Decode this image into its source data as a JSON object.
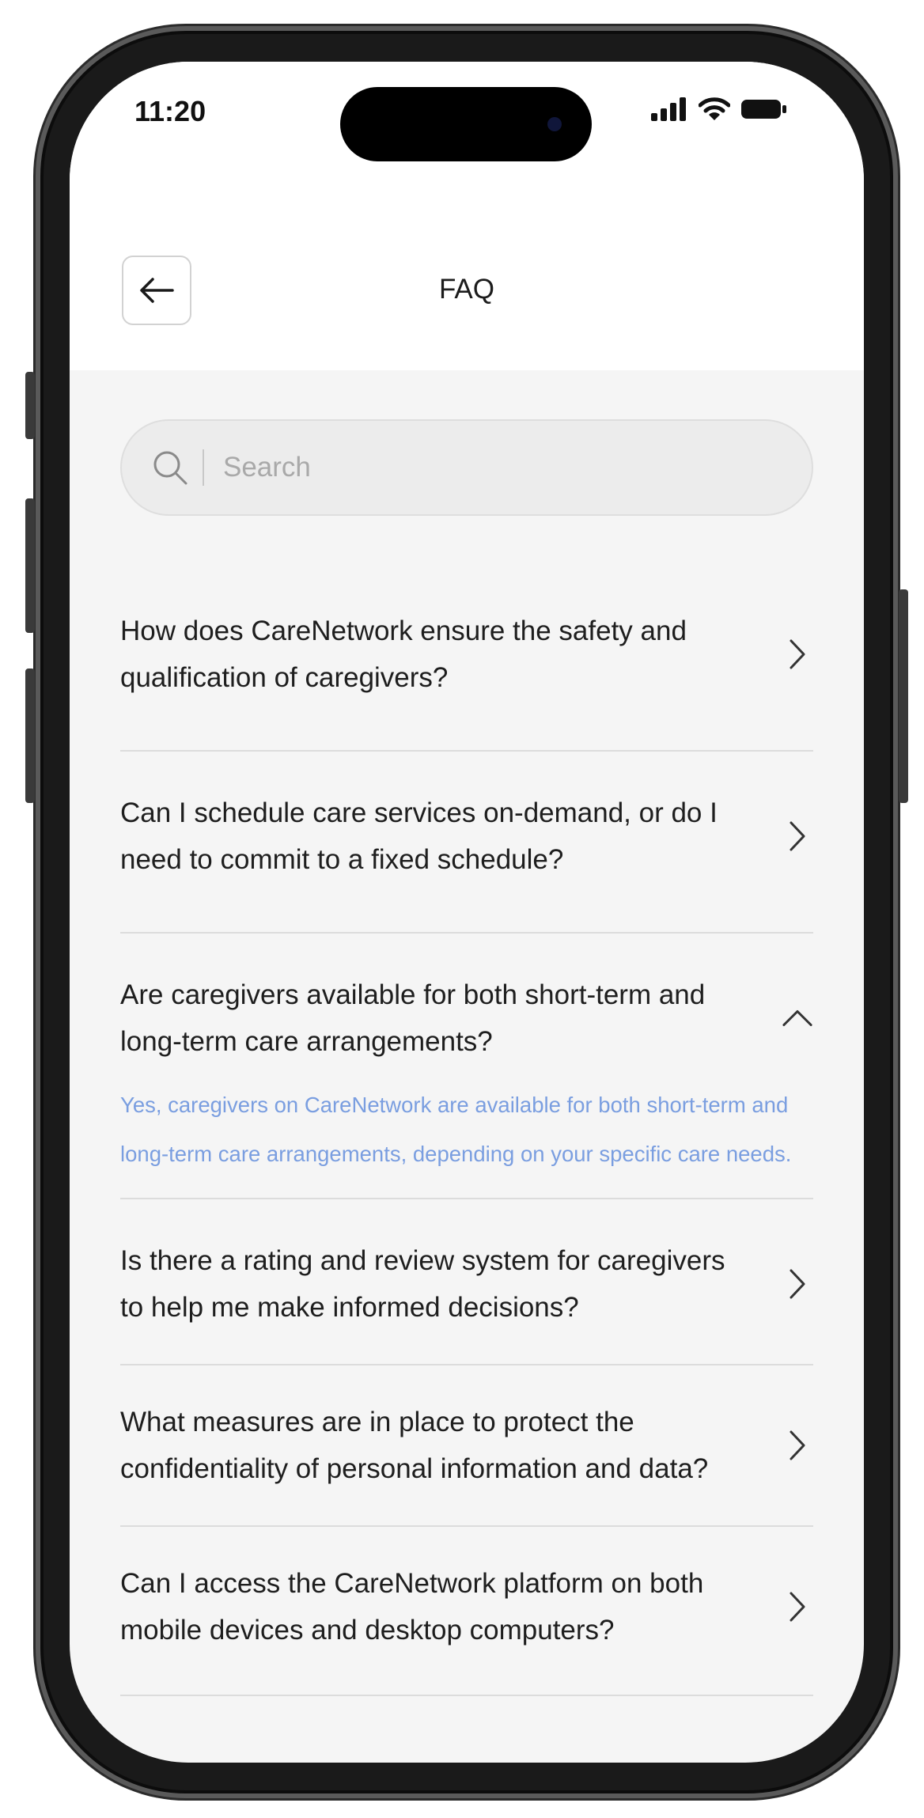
{
  "status_bar": {
    "time": "11:20"
  },
  "header": {
    "title": "FAQ"
  },
  "search": {
    "placeholder": "Search",
    "value": ""
  },
  "faq": {
    "items": [
      {
        "question": "How does CareNetwork ensure the safety and qualification of caregivers?",
        "expanded": false
      },
      {
        "question": "Can I schedule care services on-demand, or do I need to commit to a fixed schedule?",
        "expanded": false
      },
      {
        "question": "Are caregivers available for both short-term and long-term care arrangements?",
        "expanded": true,
        "answer": "Yes, caregivers on CareNetwork are available for both short-term and long-term care arrangements, depending on your specific care needs."
      },
      {
        "question": "Is there a rating and review system for caregivers to help me make informed decisions?",
        "expanded": false
      },
      {
        "question": "What measures are in place to protect the confidentiality of personal information and data?",
        "expanded": false
      },
      {
        "question": "Can I access the CareNetwork platform on both mobile devices and desktop computers?",
        "expanded": false
      }
    ]
  },
  "colors": {
    "answer_text": "#7a9ee0",
    "screen_background": "#f5f5f5",
    "divider": "#dcdcdc"
  }
}
